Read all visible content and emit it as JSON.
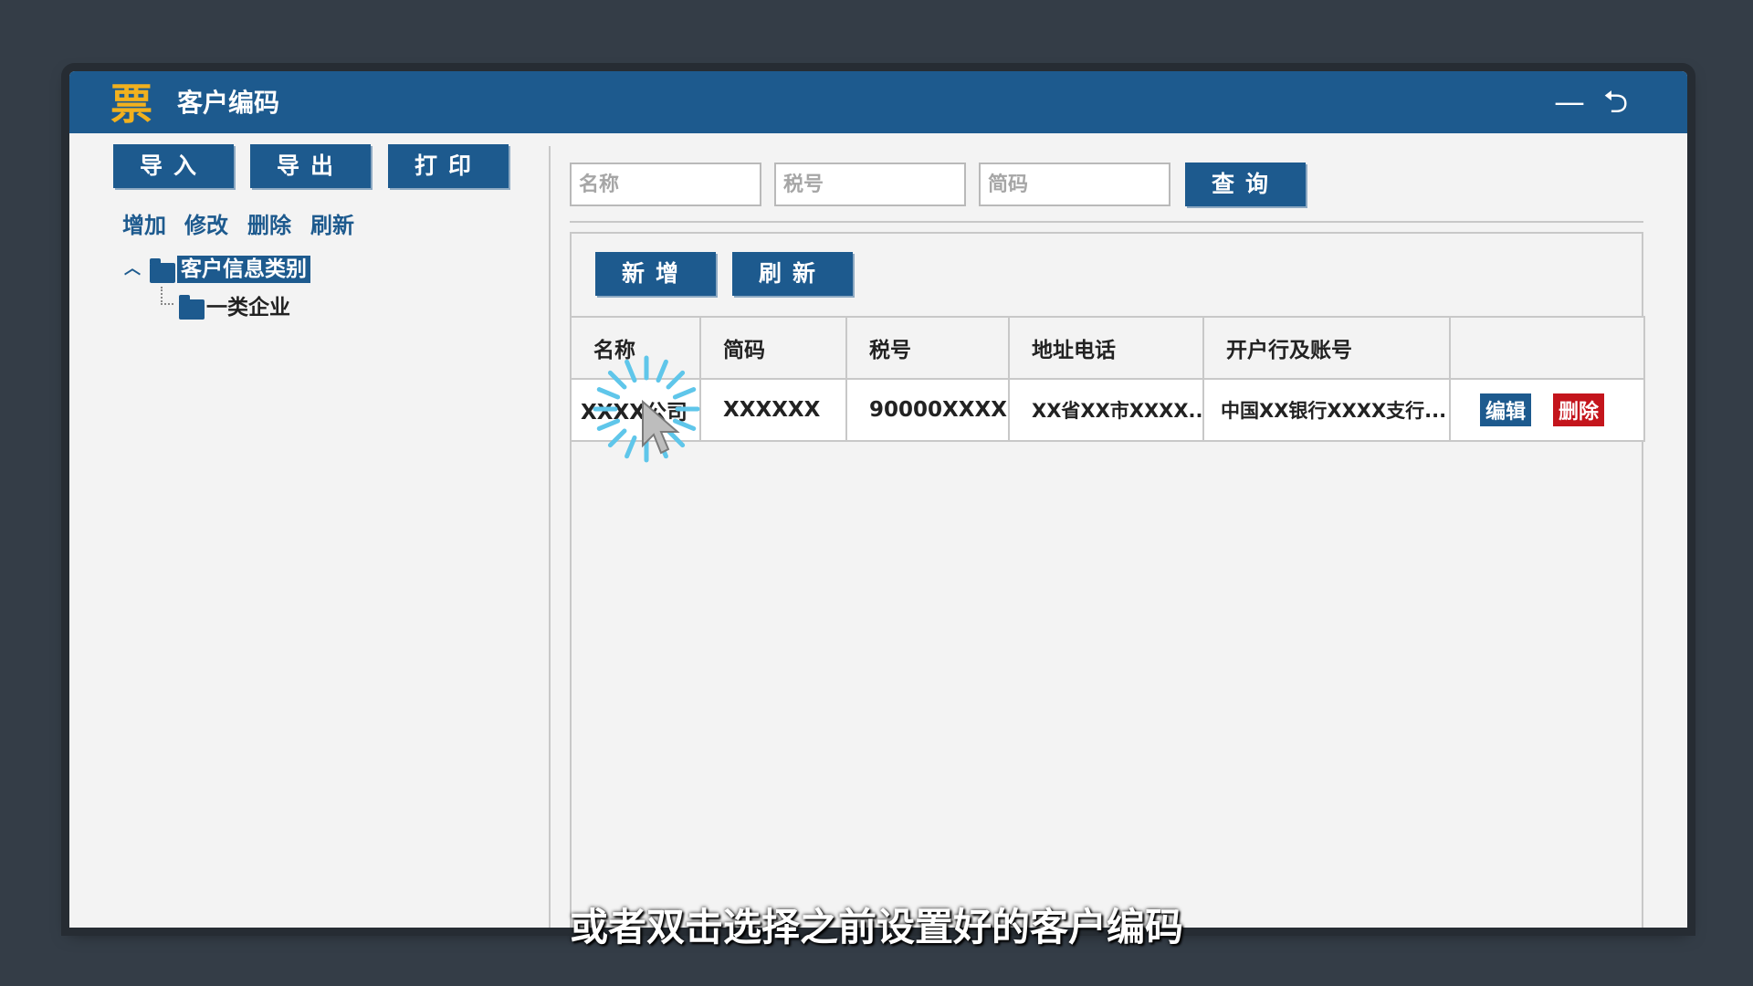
{
  "window": {
    "logo_glyph": "票",
    "title": "客户编码",
    "minimize_glyph": "—",
    "back_glyph": "⮌"
  },
  "left_panel": {
    "import_label": "导入",
    "export_label": "导出",
    "print_label": "打印",
    "links": [
      "增加",
      "修改",
      "删除",
      "刷新"
    ],
    "tree": {
      "root": "客户信息类别",
      "children": [
        "一类企业"
      ]
    }
  },
  "search": {
    "name_placeholder": "名称",
    "tax_placeholder": "税号",
    "code_placeholder": "简码",
    "query_label": "查询"
  },
  "toolbar": {
    "add_label": "新增",
    "refresh_label": "刷新"
  },
  "table": {
    "columns": [
      "名称",
      "简码",
      "税号",
      "地址电话",
      "开户行及账号",
      ""
    ],
    "rows": [
      {
        "name": "XXXX公司",
        "code": "XXXXXX",
        "tax": "90000XXXX",
        "address": "XX省XX市XXXX...",
        "bank": "中国XX银行XXXX支行...",
        "edit_label": "编辑",
        "delete_label": "删除"
      }
    ]
  },
  "subtitle": "或者双击选择之前设置好的客户编码",
  "colors": {
    "brand": "#1d5a8e",
    "logo": "#f2b11e",
    "danger": "#c4151c",
    "spinner": "#5fc6ea"
  }
}
